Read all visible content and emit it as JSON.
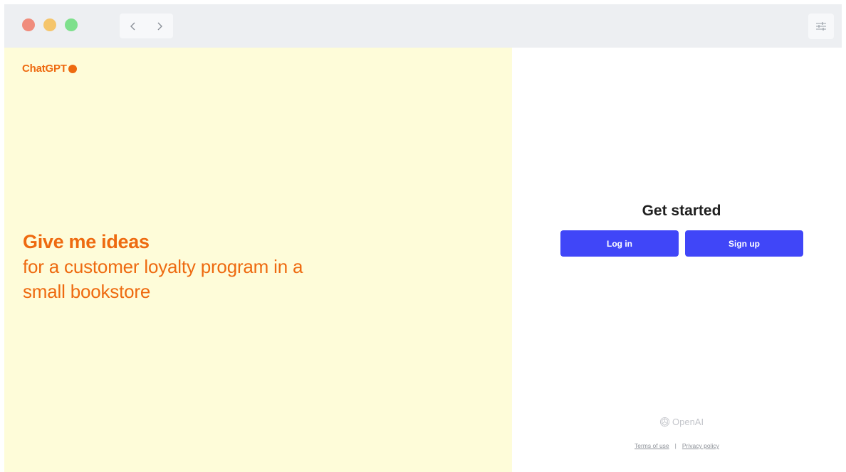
{
  "window": {
    "nav": {
      "back_icon": "chevron-left-icon",
      "forward_icon": "chevron-right-icon"
    },
    "settings_icon": "sliders-icon",
    "traffic_colors": {
      "close": "#f08c7c",
      "minimize": "#f5c56b",
      "maximize": "#7ee08c"
    }
  },
  "left": {
    "brand": "ChatGPT",
    "brand_color": "#ee6a10",
    "background": "#fefcd9",
    "prompt_title": "Give me ideas",
    "prompt_line1": "for a customer loyalty program in a",
    "prompt_line2": "small bookstore"
  },
  "right": {
    "heading": "Get started",
    "login_label": "Log in",
    "signup_label": "Sign up",
    "button_color": "#4046f8",
    "logo_text": "OpenAI",
    "terms_label": "Terms of use",
    "separator": "|",
    "privacy_label": "Privacy policy"
  }
}
